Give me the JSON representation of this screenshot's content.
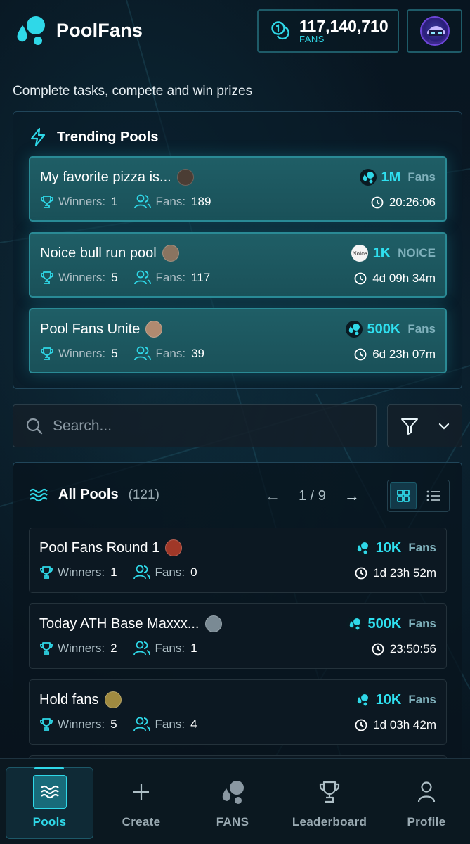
{
  "app": {
    "name": "PoolFans"
  },
  "balance": {
    "amount": "117,140,710",
    "unit": "FANS"
  },
  "tagline": "Complete tasks, compete and win prizes",
  "trending": {
    "title": "Trending Pools",
    "cards": [
      {
        "name": "My favorite pizza is...",
        "prize_value": "1M",
        "prize_unit": "Fans",
        "winners_label": "Winners:",
        "winners": "1",
        "fans_label": "Fans:",
        "fans": "189",
        "time": "20:26:06",
        "avatar_color": "#5b4a3a"
      },
      {
        "name": "Noice bull run pool",
        "prize_value": "1K",
        "prize_unit": "NOICE",
        "winners_label": "Winners:",
        "winners": "5",
        "fans_label": "Fans:",
        "fans": "117",
        "time": "4d 09h 34m",
        "avatar_color": "#8a7460"
      },
      {
        "name": "Pool Fans Unite",
        "prize_value": "500K",
        "prize_unit": "Fans",
        "winners_label": "Winners:",
        "winners": "5",
        "fans_label": "Fans:",
        "fans": "39",
        "time": "6d 23h 07m",
        "avatar_color": "#b08a70"
      }
    ]
  },
  "search": {
    "placeholder": "Search..."
  },
  "all_pools": {
    "title": "All Pools",
    "count": "(121)",
    "page": "1 / 9",
    "prev": "←",
    "next": "→",
    "cards": [
      {
        "name": "Pool Fans Round 1",
        "prize_value": "10K",
        "prize_unit": "Fans",
        "winners_label": "Winners:",
        "winners": "1",
        "fans_label": "Fans:",
        "fans": "0",
        "time": "1d 23h 52m",
        "avatar_color": "#a03828"
      },
      {
        "name": "Today ATH Base Maxxx...",
        "prize_value": "500K",
        "prize_unit": "Fans",
        "winners_label": "Winners:",
        "winners": "2",
        "fans_label": "Fans:",
        "fans": "1",
        "time": "23:50:56",
        "avatar_color": "#7a8a94"
      },
      {
        "name": "Hold fans",
        "prize_value": "10K",
        "prize_unit": "Fans",
        "winners_label": "Winners:",
        "winners": "5",
        "fans_label": "Fans:",
        "fans": "4",
        "time": "1d 03h 42m",
        "avatar_color": "#a08a40"
      }
    ]
  },
  "nav": {
    "pools": "Pools",
    "create": "Create",
    "fans": "FANS",
    "leaderboard": "Leaderboard",
    "profile": "Profile"
  },
  "colors": {
    "accent": "#2fd8e8",
    "card_trending": "#1f5e66",
    "background": "#07121b"
  }
}
